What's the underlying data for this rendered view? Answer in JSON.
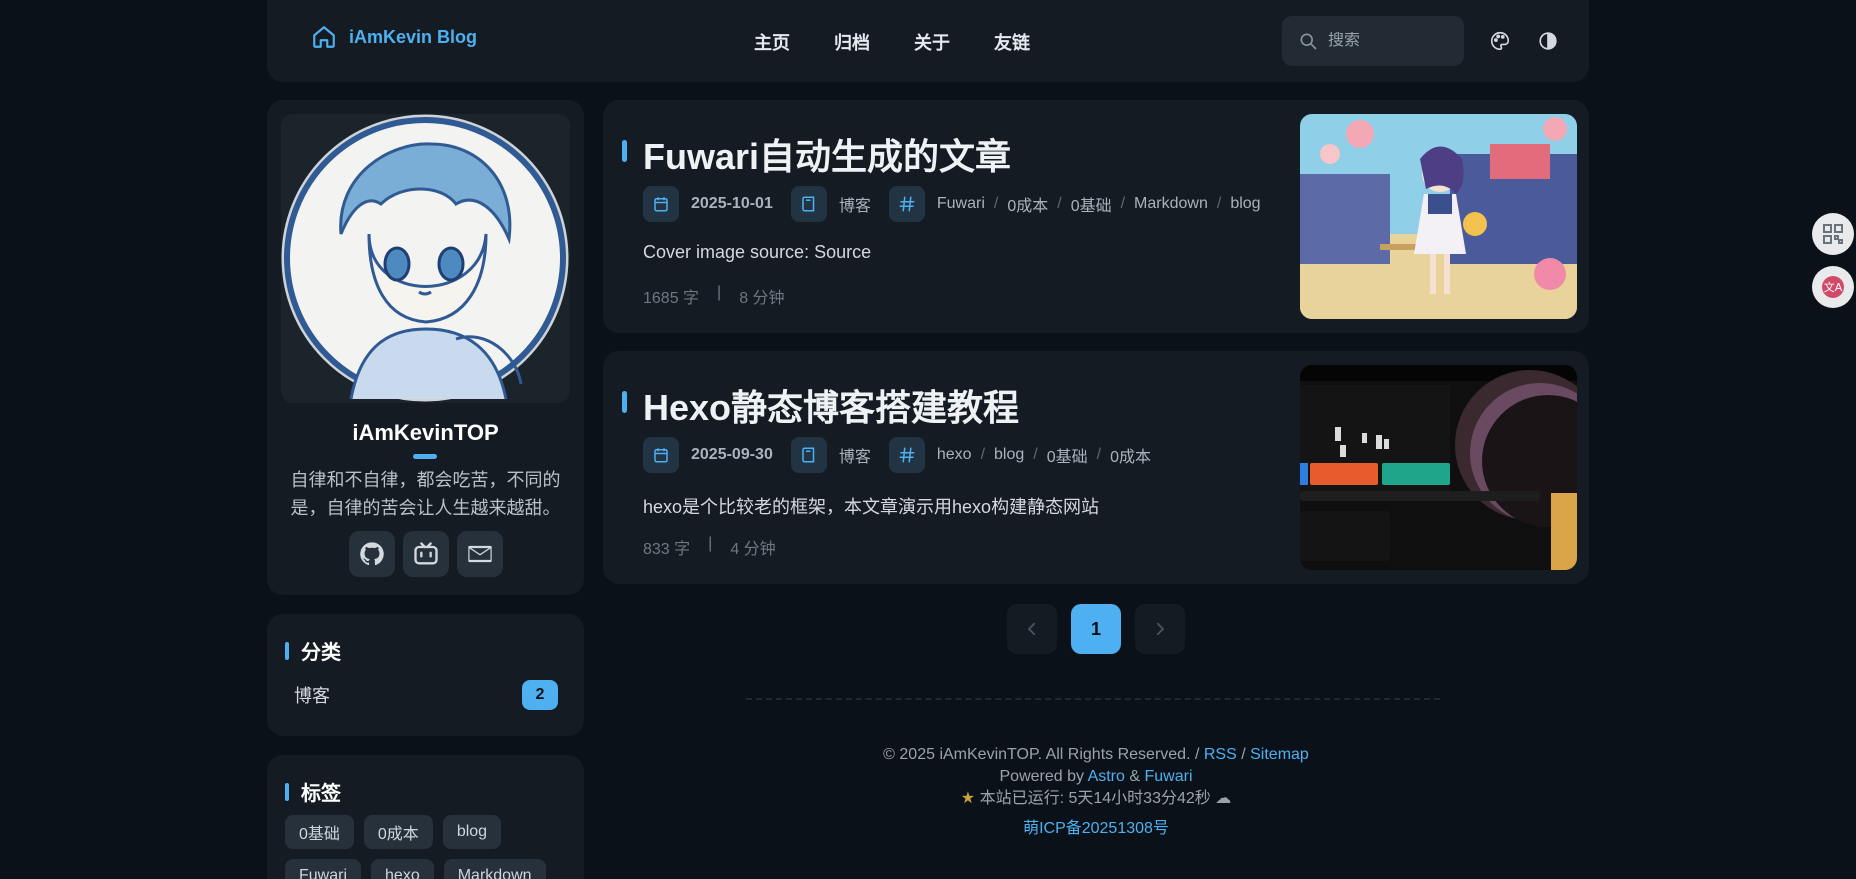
{
  "header": {
    "brand": "iAmKevin Blog",
    "nav": [
      "主页",
      "归档",
      "关于",
      "友链"
    ],
    "search_placeholder": "搜索"
  },
  "profile": {
    "name": "iAmKevinTOP",
    "bio": "自律和不自律，都会吃苦，不同的是，自律的苦会让人生越来越甜。"
  },
  "categories": {
    "title": "分类",
    "items": [
      {
        "label": "博客",
        "count": "2"
      }
    ]
  },
  "tags": {
    "title": "标签",
    "items": [
      "0基础",
      "0成本",
      "blog",
      "Fuwari",
      "hexo",
      "Markdown"
    ]
  },
  "posts": [
    {
      "title": "Fuwari自动生成的文章",
      "date": "2025-10-01",
      "category": "博客",
      "tags": [
        "Fuwari",
        "0成本",
        "0基础",
        "Markdown",
        "blog"
      ],
      "description": "Cover image source: Source",
      "words": "1685 字",
      "read_time": "8 分钟"
    },
    {
      "title": "Hexo静态博客搭建教程",
      "date": "2025-09-30",
      "category": "博客",
      "tags": [
        "hexo",
        "blog",
        "0基础",
        "0成本"
      ],
      "description": "hexo是个比较老的框架，本文章演示用hexo构建静态网站",
      "words": "833 字",
      "read_time": "4 分钟"
    }
  ],
  "pagination": {
    "current": "1"
  },
  "footer": {
    "copyright": "© 2025 iAmKevinTOP. All Rights Reserved. /",
    "rss": "RSS",
    "slash": "/",
    "sitemap": "Sitemap",
    "powered_by": "Powered by",
    "astro": "Astro",
    "amp": "&",
    "fuwari": "Fuwari",
    "runtime": "本站已运行: 5天14小时33分42秒",
    "icp": "萌ICP备20251308号"
  },
  "colors": {
    "accent": "#4eb0f0",
    "background": "#0b1118",
    "card": "#141b22"
  }
}
